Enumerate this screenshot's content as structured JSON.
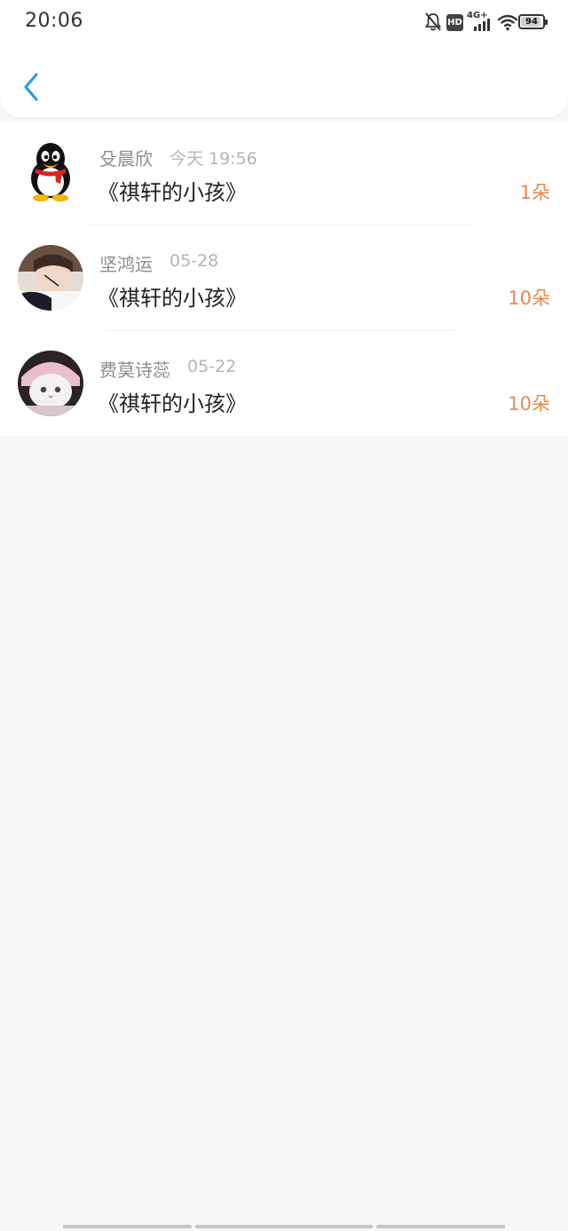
{
  "status_bar": {
    "time": "20:06",
    "network": "4G+",
    "hd_label": "HD",
    "battery": "94"
  },
  "nav": {
    "back_icon": "chevron-left-icon"
  },
  "colors": {
    "accent_blue": "#2a9be6",
    "amount_orange": "#e8874d",
    "name_gray": "#8c8c8c",
    "date_gray": "#b5b5b5"
  },
  "gifts": [
    {
      "name": "殳晨欣",
      "date": "今天 19:56",
      "title": "《祺轩的小孩》",
      "amount": "1朵",
      "avatar": "qq-penguin-avatar"
    },
    {
      "name": "坚鸿运",
      "date": "05-28",
      "title": "《祺轩的小孩》",
      "amount": "10朵",
      "avatar": "user-photo-avatar"
    },
    {
      "name": "费莫诗蕊",
      "date": "05-22",
      "title": "《祺轩的小孩》",
      "amount": "10朵",
      "avatar": "cat-photo-avatar"
    }
  ]
}
